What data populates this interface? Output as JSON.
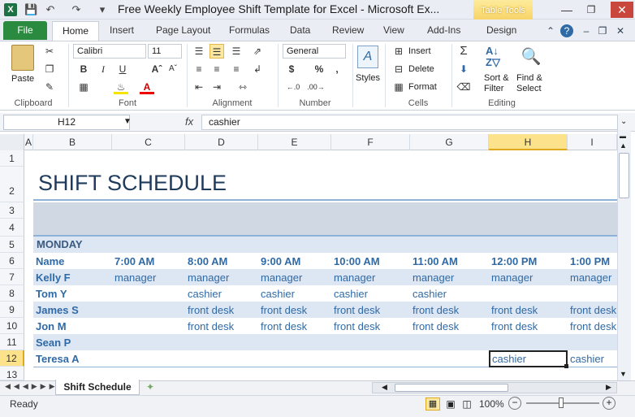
{
  "title": "Free Weekly Employee Shift Template for Excel  -  Microsoft Ex...",
  "contextual_tab_group": "Table Tools",
  "tabs": [
    "File",
    "Home",
    "Insert",
    "Page Layout",
    "Formulas",
    "Data",
    "Review",
    "View",
    "Add-Ins",
    "Design"
  ],
  "ribbon": {
    "clipboard": {
      "paste": "Paste",
      "label": "Clipboard"
    },
    "font": {
      "name": "Calibri",
      "size": "11",
      "bold": "B",
      "italic": "I",
      "underline": "U",
      "label": "Font"
    },
    "alignment": {
      "label": "Alignment"
    },
    "number": {
      "format": "General",
      "currency": "$",
      "percent": "%",
      "comma": ",",
      "label": "Number"
    },
    "styles": {
      "label": "Styles"
    },
    "cells": {
      "insert": "Insert",
      "delete": "Delete",
      "format": "Format",
      "label": "Cells"
    },
    "editing": {
      "sort": "Sort &",
      "filter": "Filter",
      "find": "Find &",
      "select": "Select",
      "label": "Editing"
    }
  },
  "namebox": "H12",
  "formula": "cashier",
  "columns": [
    "A",
    "B",
    "C",
    "D",
    "E",
    "F",
    "G",
    "H",
    "I"
  ],
  "rows": [
    "1",
    "2",
    "3",
    "4",
    "5",
    "6",
    "7",
    "8",
    "9",
    "10",
    "11",
    "12",
    "13"
  ],
  "sheet": {
    "title": "SHIFT SCHEDULE",
    "day": "MONDAY",
    "header": [
      "Name",
      "7:00 AM",
      "8:00 AM",
      "9:00 AM",
      "10:00 AM",
      "11:00 AM",
      "12:00 PM",
      "1:00 PM"
    ],
    "employees": [
      [
        "Kelly F",
        "manager",
        "manager",
        "manager",
        "manager",
        "manager",
        "manager",
        "manager"
      ],
      [
        "Tom Y",
        "",
        "cashier",
        "cashier",
        "cashier",
        "cashier",
        "",
        ""
      ],
      [
        "James S",
        "",
        "front desk",
        "front desk",
        "front desk",
        "front desk",
        "front desk",
        "front desk"
      ],
      [
        "Jon M",
        "",
        "front desk",
        "front desk",
        "front desk",
        "front desk",
        "front desk",
        "front desk"
      ],
      [
        "Sean P",
        "",
        "",
        "",
        "",
        "",
        "",
        ""
      ],
      [
        "Teresa A",
        "",
        "",
        "",
        "",
        "",
        "cashier",
        "cashier"
      ]
    ]
  },
  "sheet_tab": "Shift Schedule",
  "status": {
    "ready": "Ready",
    "zoom": "100%"
  },
  "colors": {
    "accent": "#2f6aa6",
    "band": "#dde6f3",
    "header_band": "#cfd8e3",
    "file_tab": "#2a8a3f",
    "excel_green": "#1e7145"
  }
}
